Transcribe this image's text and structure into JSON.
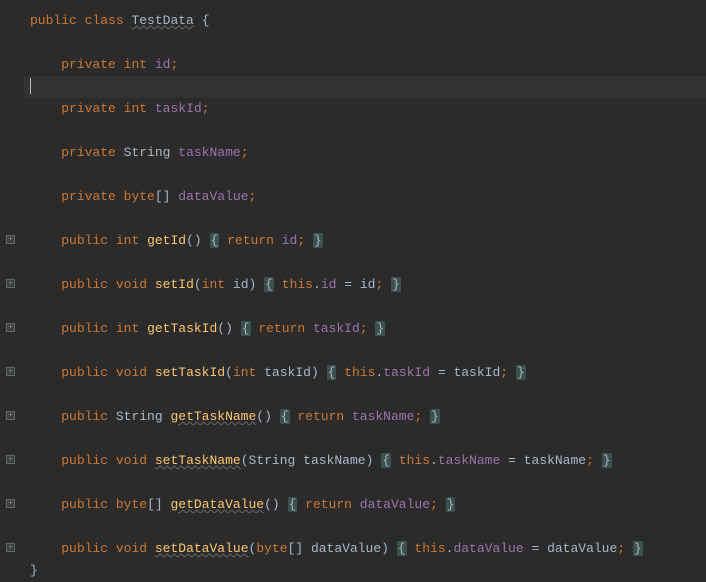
{
  "code": {
    "kw_public": "public",
    "kw_private": "private",
    "kw_class": "class",
    "kw_int": "int",
    "kw_void": "void",
    "kw_byte": "byte",
    "kw_return": "return",
    "kw_this": "this",
    "type_string": "String",
    "className": "TestData",
    "fields": {
      "id": "id",
      "taskId": "taskId",
      "taskName": "taskName",
      "dataValue": "dataValue"
    },
    "methods": {
      "getId": "getId",
      "setId": "setId",
      "getTaskId": "getTaskId",
      "setTaskId": "setTaskId",
      "getTaskName": "getTaskName",
      "setTaskName": "setTaskName",
      "getDataValue": "getDataValue",
      "setDataValue": "setDataValue"
    },
    "braces": {
      "open": "{",
      "close": "}",
      "openClose": "()",
      "brackets": "[]"
    },
    "semi": ";",
    "dot": ".",
    "eq": " = ",
    "comma": ", ",
    "foldSymbol": "+"
  }
}
